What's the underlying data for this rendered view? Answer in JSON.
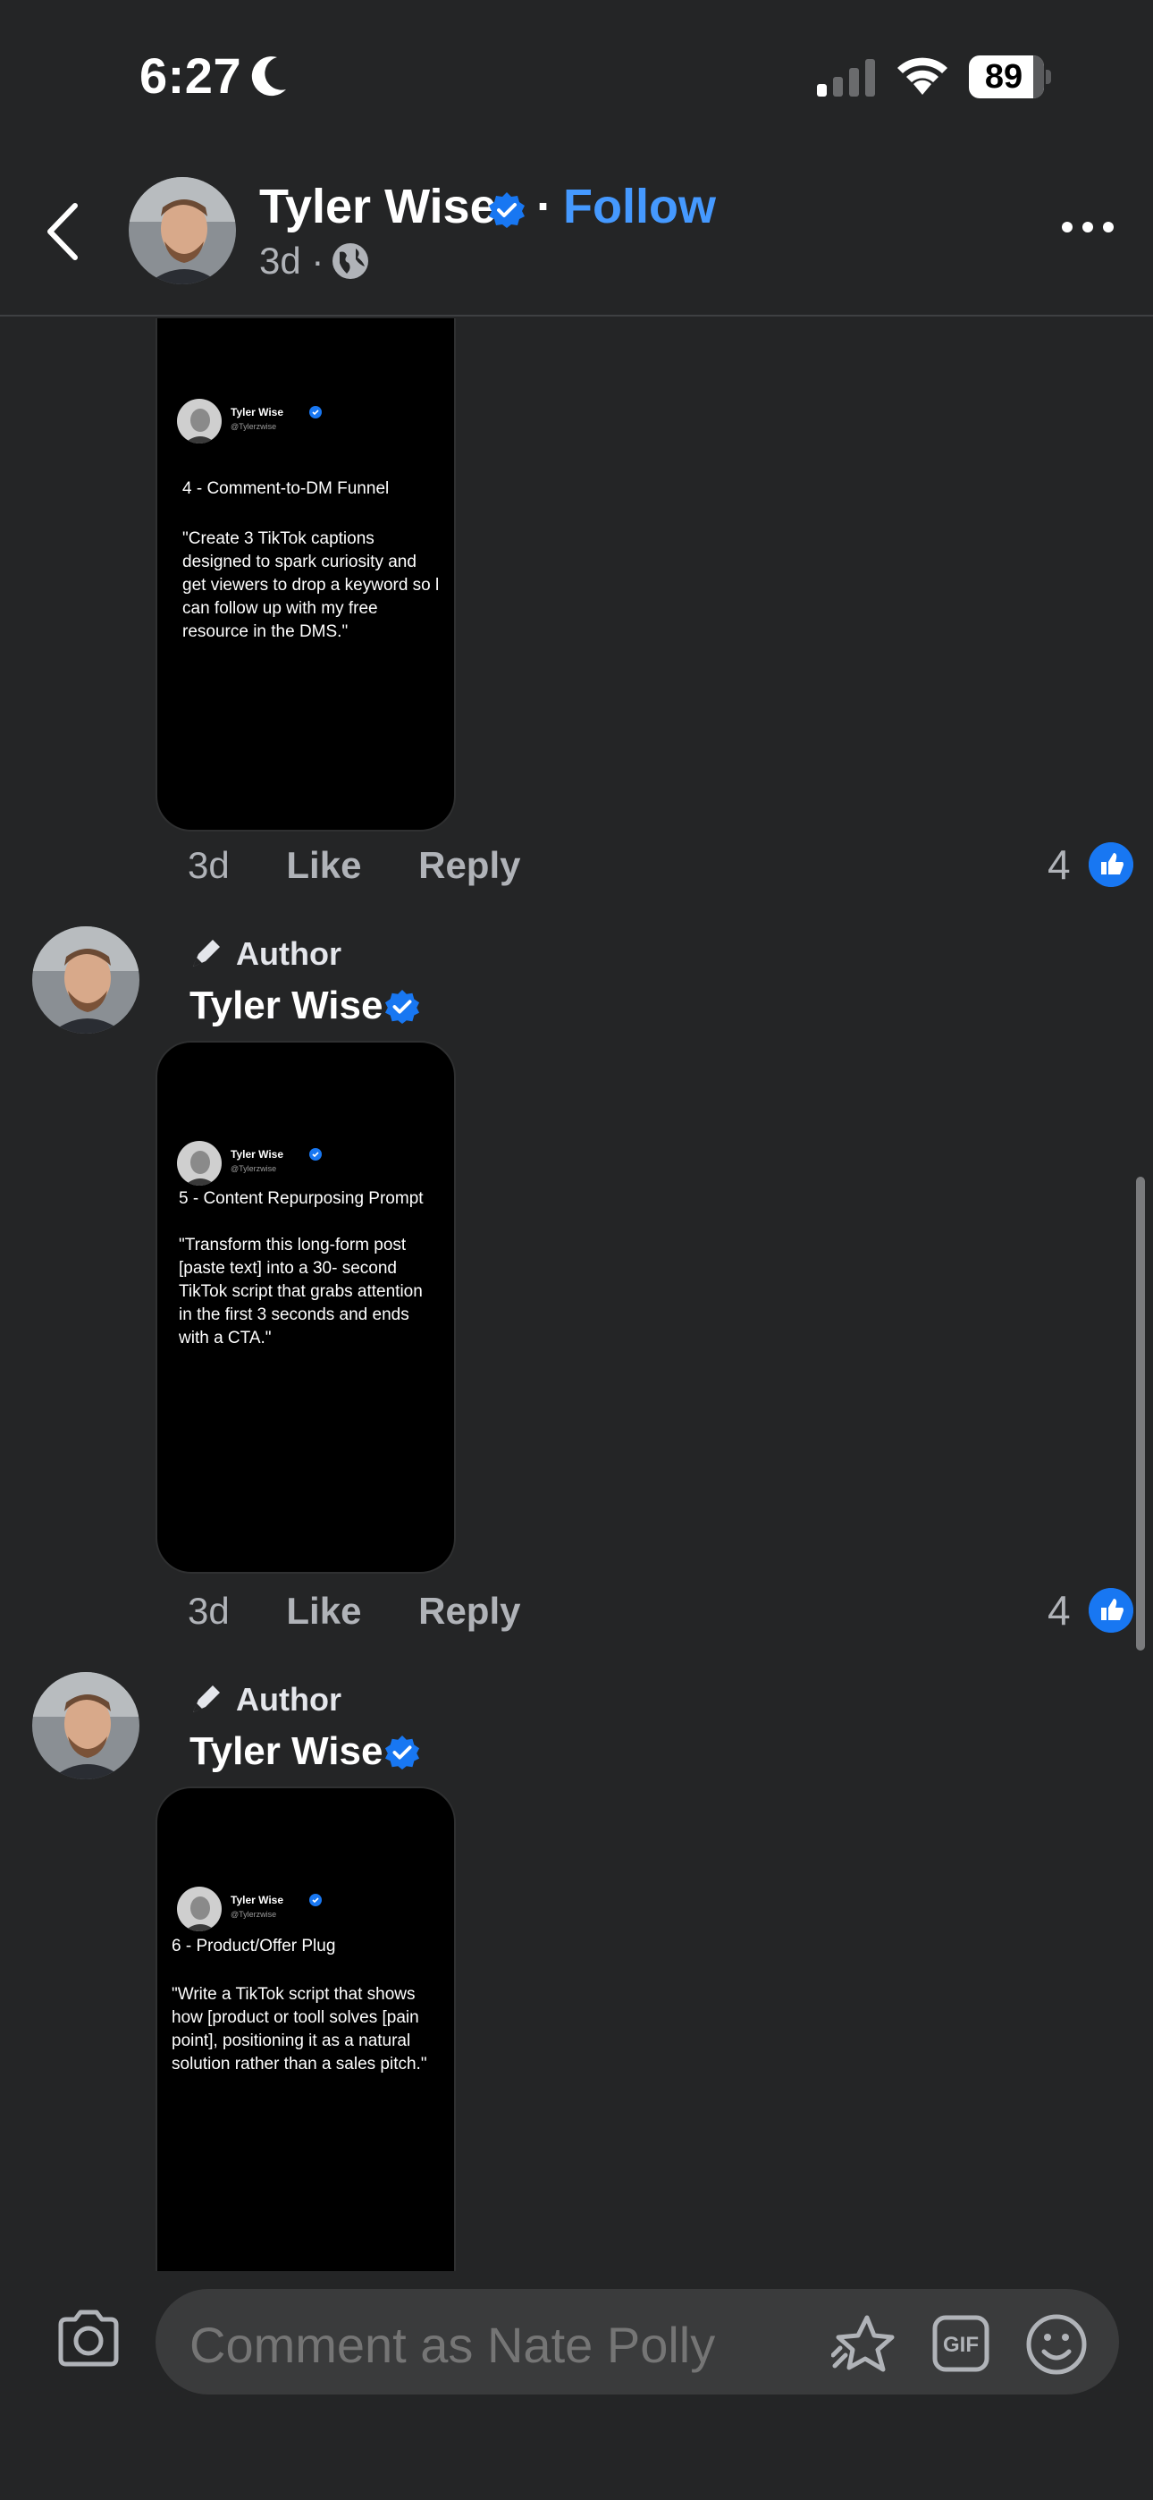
{
  "status_bar": {
    "time": "6:27",
    "battery": "89"
  },
  "header": {
    "name": "Tyler Wise",
    "separator": "·",
    "follow_label": "Follow",
    "age": "3d ·"
  },
  "comments": [
    {
      "card": {
        "name": "Tyler Wise",
        "handle": "@Tylerzwise",
        "title": "4 - Comment-to-DM Funnel",
        "body": "\"Create 3 TikTok captions designed to spark curiosity and get viewers to drop a keyword so l can follow up with my free resource in the DMS.\""
      },
      "age": "3d",
      "like_label": "Like",
      "reply_label": "Reply",
      "reaction_count": "4"
    },
    {
      "author_label": "Author",
      "name": "Tyler Wise",
      "card": {
        "name": "Tyler Wise",
        "handle": "@Tylerzwise",
        "title": "5 - Content Repurposing Prompt",
        "body": "\"Transform this long-form post [paste text] into a 30- second TikTok script that grabs attention in the first 3 seconds and ends with a CTA.\""
      },
      "age": "3d",
      "like_label": "Like",
      "reply_label": "Reply",
      "reaction_count": "4"
    },
    {
      "author_label": "Author",
      "name": "Tyler Wise",
      "card": {
        "name": "Tyler Wise",
        "handle": "@Tylerzwise",
        "title": "6 - Product/Offer Plug",
        "body": "\"Write a TikTok script that shows how [product or tooll solves [pain point], positioning it as a natural solution rather than a sales pitch.\""
      }
    }
  ],
  "composer": {
    "placeholder": "Comment as Nate Polly"
  },
  "icons": {
    "back": "chevron-left-icon",
    "verified": "verified-badge-icon",
    "globe": "globe-icon",
    "more": "more-horizontal-icon",
    "author": "pen-icon",
    "like_reaction": "thumbs-up-icon",
    "camera": "camera-icon",
    "sticker": "sticker-icon",
    "gif": "gif-icon",
    "emoji": "emoji-icon"
  },
  "colors": {
    "background": "#242526",
    "accent": "#4599ff",
    "verified": "#1877f2",
    "muted_text": "#b0b3b8"
  }
}
